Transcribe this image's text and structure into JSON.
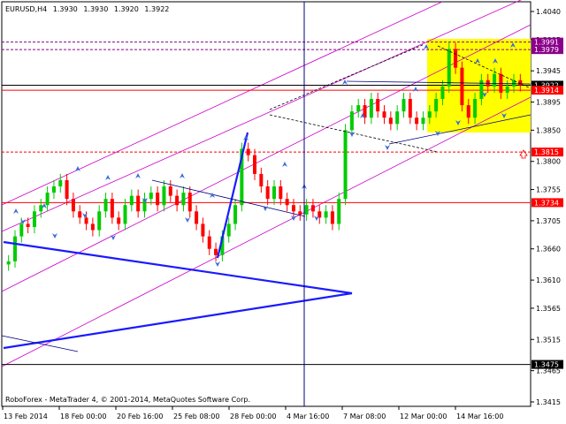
{
  "header": {
    "symbol": "EURUSD,H4",
    "open": "1.3930",
    "high": "1.3930",
    "low": "1.3920",
    "close": "1.3922"
  },
  "footer": {
    "copyright": "RoboForex - MetaTrader 4, © 2001-2014, MetaQuotes Software Corp."
  },
  "chart_data": {
    "type": "candlestick",
    "title": "EURUSD,H4",
    "xlabel": "",
    "ylabel": "",
    "ylim": [
      1.3415,
      1.404
    ],
    "y_ticks": [
      "1.4040",
      "1.3995",
      "1.3945",
      "1.3895",
      "1.3850",
      "1.3800",
      "1.3755",
      "1.3705",
      "1.3660",
      "1.3610",
      "1.3565",
      "1.3515",
      "1.3465",
      "1.3415"
    ],
    "x_ticks": [
      "13 Feb 2014",
      "18 Feb 00:00",
      "20 Feb 16:00",
      "25 Feb 08:00",
      "28 Feb 00:00",
      "4 Mar 16:00",
      "7 Mar 08:00",
      "12 Mar 00:00",
      "14 Mar 16:00"
    ],
    "grid": false,
    "price_levels": [
      {
        "label": "1.3991",
        "value": 1.3991,
        "style": "dashed",
        "color": "#8a008a"
      },
      {
        "label": "1.3979",
        "value": 1.3979,
        "style": "dashed",
        "color": "#8a008a"
      },
      {
        "label": "1.3922",
        "value": 1.3922,
        "style": "solid",
        "color": "#000000"
      },
      {
        "label": "1.3914",
        "value": 1.3914,
        "style": "solid",
        "color": "#ff0000"
      },
      {
        "label": "1.3815",
        "value": 1.3815,
        "style": "dashed",
        "color": "#ff0000"
      },
      {
        "label": "1.3734",
        "value": 1.3734,
        "style": "solid",
        "color": "#ff0000"
      },
      {
        "label": "1.3475",
        "value": 1.3475,
        "style": "solid",
        "color": "#000000"
      }
    ],
    "colors": {
      "bull": "#00cc00",
      "bear": "#ff0000",
      "channel": "#cc00cc",
      "trend": "#1a1aff",
      "projection": "#ffff00"
    }
  }
}
